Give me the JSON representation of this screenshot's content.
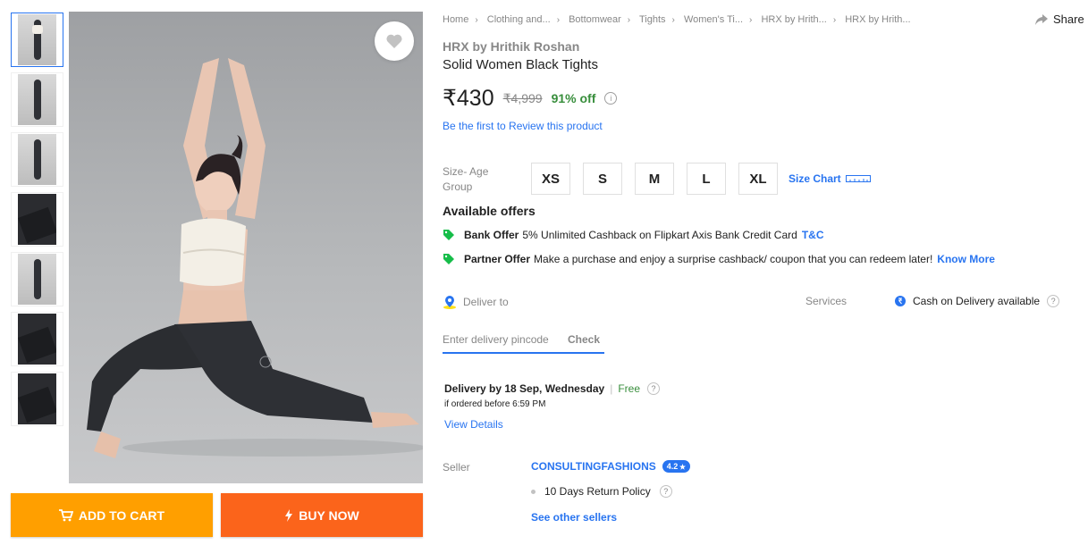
{
  "gallery": {
    "thumbnails": [
      "thumb-1",
      "thumb-2",
      "thumb-3",
      "thumb-4",
      "thumb-5",
      "thumb-6",
      "thumb-7"
    ]
  },
  "actions": {
    "add_to_cart": "ADD TO CART",
    "buy_now": "BUY NOW"
  },
  "breadcrumb": [
    "Home",
    "Clothing and...",
    "Bottomwear",
    "Tights",
    "Women's Ti...",
    "HRX by Hrith...",
    "HRX by Hrith..."
  ],
  "share_label": "Share",
  "product": {
    "brand": "HRX by Hrithik Roshan",
    "title": "Solid Women Black Tights",
    "price": "₹430",
    "mrp": "₹4,999",
    "discount": "91% off",
    "review_link": "Be the first to Review this product"
  },
  "size": {
    "label": "Size- Age Group",
    "options": [
      "XS",
      "S",
      "M",
      "L",
      "XL"
    ],
    "chart_label": "Size Chart"
  },
  "offers": {
    "heading": "Available offers",
    "items": [
      {
        "type": "Bank Offer",
        "text": "5% Unlimited Cashback on Flipkart Axis Bank Credit Card",
        "link": "T&C"
      },
      {
        "type": "Partner Offer",
        "text": "Make a purchase and enjoy a surprise cashback/ coupon that you can redeem later!",
        "link": "Know More"
      }
    ]
  },
  "delivery": {
    "deliver_to": "Deliver to",
    "pincode_placeholder": "Enter delivery pincode",
    "check": "Check",
    "date_text": "Delivery by 18 Sep, Wednesday",
    "free": "Free",
    "order_before": "if ordered before 6:59 PM",
    "view_details": "View Details"
  },
  "services": {
    "label": "Services",
    "cod": "Cash on Delivery available"
  },
  "seller": {
    "label": "Seller",
    "name": "CONSULTINGFASHIONS",
    "rating": "4.2",
    "return_policy": "10 Days Return Policy",
    "other_sellers": "See other sellers"
  },
  "colors": {
    "accent": "#2874f0",
    "cart": "#ff9f00",
    "buy": "#fb641b",
    "green": "#388e3c"
  }
}
